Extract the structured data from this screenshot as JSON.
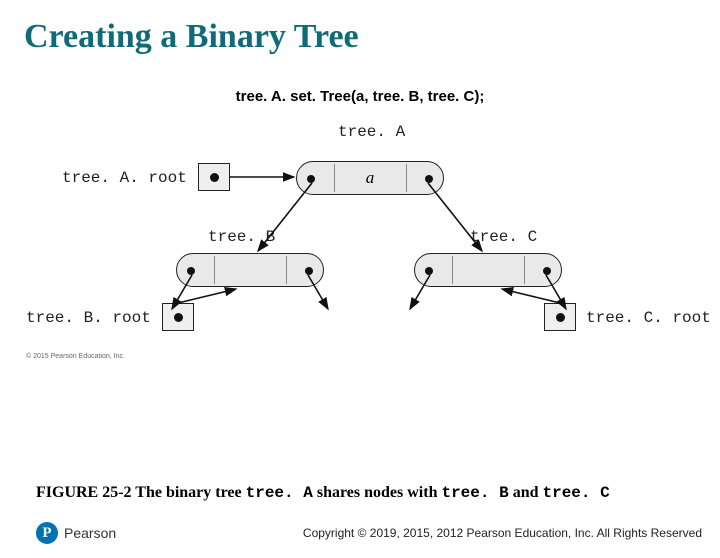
{
  "title": "Creating a Binary Tree",
  "code_call": "tree. A. set. Tree(a, tree. B, tree. C);",
  "diagram": {
    "label_treeA": "tree. A",
    "label_treeA_root": "tree. A. root",
    "label_treeB": "tree. B",
    "label_treeB_root": "tree. B. root",
    "label_treeC": "tree. C",
    "label_treeC_root": "tree. C. root",
    "node_a": "a",
    "fig_copyright": "© 2015 Pearson Education, Inc."
  },
  "caption": {
    "prefix": "FIGURE 25-2 The binary tree ",
    "t1": "tree. A",
    "mid1": " shares nodes with ",
    "t2": "tree. B",
    "mid2": " and ",
    "t3": "tree. C"
  },
  "footer": "Copyright © 2019, 2015, 2012 Pearson Education, Inc. All Rights Reserved",
  "logo": {
    "letter": "P",
    "name": "Pearson"
  }
}
